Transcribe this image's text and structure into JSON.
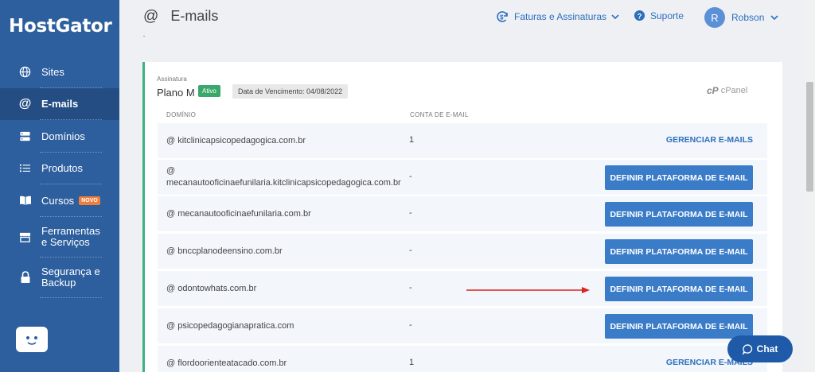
{
  "brand": "HostGator",
  "sidebar": {
    "items": [
      {
        "label": "Sites",
        "icon": "globe-icon"
      },
      {
        "label": "E-mails",
        "icon": "at-icon"
      },
      {
        "label": "Domínios",
        "icon": "server-icon"
      },
      {
        "label": "Produtos",
        "icon": "list-icon"
      },
      {
        "label": "Cursos",
        "icon": "book-icon",
        "badge": "NOVO"
      },
      {
        "label1": "Ferramentas",
        "label2": "e Serviços",
        "icon": "store-icon"
      },
      {
        "label1": "Segurança e",
        "label2": "Backup",
        "icon": "lock-icon"
      }
    ]
  },
  "header": {
    "at": "@",
    "title": "E-mails",
    "billing": "Faturas e Assinaturas",
    "support": "Suporte",
    "user_initial": "R",
    "user_name": "Robson"
  },
  "card": {
    "assinatura": "Assinatura",
    "plano": "Plano M",
    "status": "Ativo",
    "vencimento": "Data de Vencimento: 04/08/2022",
    "cpanel_logo": "cP",
    "cpanel_text": "cPanel",
    "col_dominio": "DOMÍNIO",
    "col_conta": "CONTA DE E-MAIL"
  },
  "rows": [
    {
      "line1": "@ kitclinicapsicopedagogica.com.br",
      "count": "1",
      "action": "GERENCIAR E-MAILS"
    },
    {
      "line1": "@",
      "line2": "mecanautooficinaefunilaria.kitclinicapsicopedagogica.com.br",
      "count": "-",
      "action": "DEFINIR PLATAFORMA DE E-MAIL"
    },
    {
      "line1": "@ mecanautooficinaefunilaria.com.br",
      "count": "-",
      "action": "DEFINIR PLATAFORMA DE E-MAIL"
    },
    {
      "line1": "@ bnccplanodeensino.com.br",
      "count": "-",
      "action": "DEFINIR PLATAFORMA DE E-MAIL"
    },
    {
      "line1": "@ odontowhats.com.br",
      "count": "-",
      "action": "DEFINIR PLATAFORMA DE E-MAIL"
    },
    {
      "line1": "@ psicopedagogianapratica.com",
      "count": "-",
      "action": "DEFINIR PLATAFORMA DE E-MAIL"
    },
    {
      "line1": "@ flordoorienteatacado.com.br",
      "count": "1",
      "action": "GERENCIAR E-MAILS"
    }
  ],
  "chat": "Chat",
  "colors": {
    "sidebar": "#2d5f9e",
    "accent": "#3b7cc9",
    "active_green": "#3aa86b",
    "arrow": "#d9251d"
  }
}
